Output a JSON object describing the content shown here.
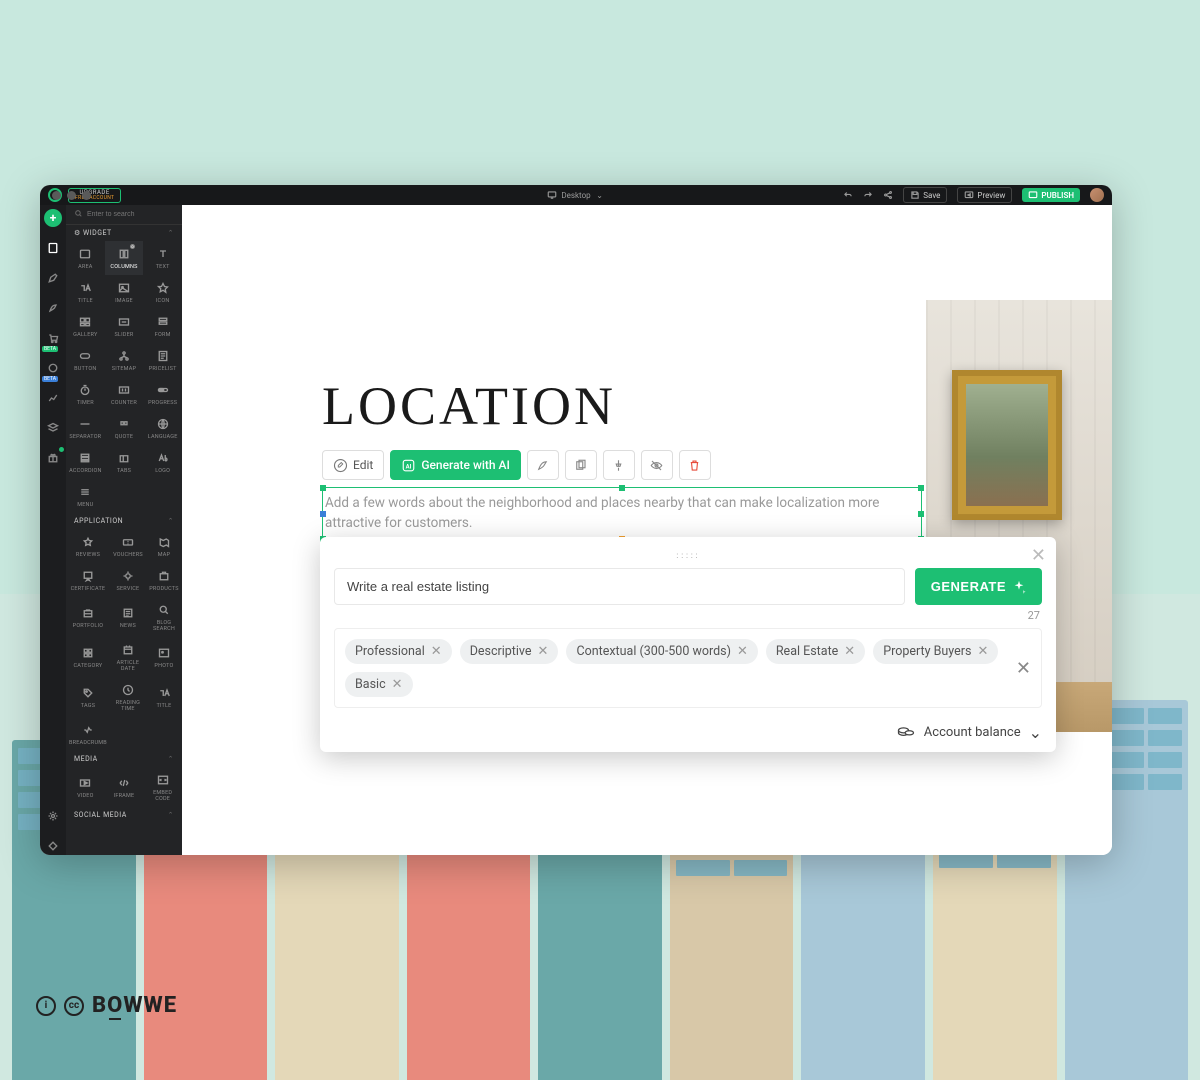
{
  "topbar": {
    "upgrade_line1": "UPGRADE",
    "upgrade_line2": "FREE ACCOUNT",
    "device_label": "Desktop",
    "save_label": "Save",
    "preview_label": "Preview",
    "publish_label": "PUBLISH"
  },
  "rail": {
    "beta_label": "BETA"
  },
  "sidebar": {
    "search_placeholder": "Enter to search",
    "sections": {
      "widget": "WIDGET",
      "application": "APPLICATION",
      "media": "MEDIA",
      "social": "SOCIAL MEDIA"
    },
    "widgets": [
      "AREA",
      "COLUMNS",
      "TEXT",
      "TITLE",
      "IMAGE",
      "ICON",
      "GALLERY",
      "SLIDER",
      "FORM",
      "BUTTON",
      "SITEMAP",
      "PRICELIST",
      "TIMER",
      "COUNTER",
      "PROGRESS",
      "SEPARATOR",
      "QUOTE",
      "LANGUAGE",
      "ACCORDION",
      "TABS",
      "LOGO",
      "MENU"
    ],
    "apps": [
      "REVIEWS",
      "VOUCHERS",
      "MAP",
      "CERTIFICATE",
      "SERVICE",
      "PRODUCTS",
      "PORTFOLIO",
      "NEWS",
      "BLOG SEARCH",
      "CATEGORY",
      "ARTICLE DATE",
      "PHOTO",
      "TAGS",
      "READING TIME",
      "TITLE",
      "BREADCRUMB"
    ],
    "media": [
      "VIDEO",
      "IFRAME",
      "EMBED CODE"
    ]
  },
  "content": {
    "heading": "LOCATION",
    "edit_label": "Edit",
    "generate_ai_label": "Generate with AI",
    "placeholder_text": "Add a few words about the neighborhood and places nearby that can make localization more attractive for customers."
  },
  "ai_panel": {
    "input_value": "Write a real estate listing",
    "generate_label": "GENERATE",
    "char_count": "27",
    "tags": [
      "Professional",
      "Descriptive",
      "Contextual (300-500 words)",
      "Real Estate",
      "Property Buyers",
      "Basic"
    ],
    "balance_label": "Account balance"
  },
  "brand": {
    "name": "BOWWE"
  }
}
